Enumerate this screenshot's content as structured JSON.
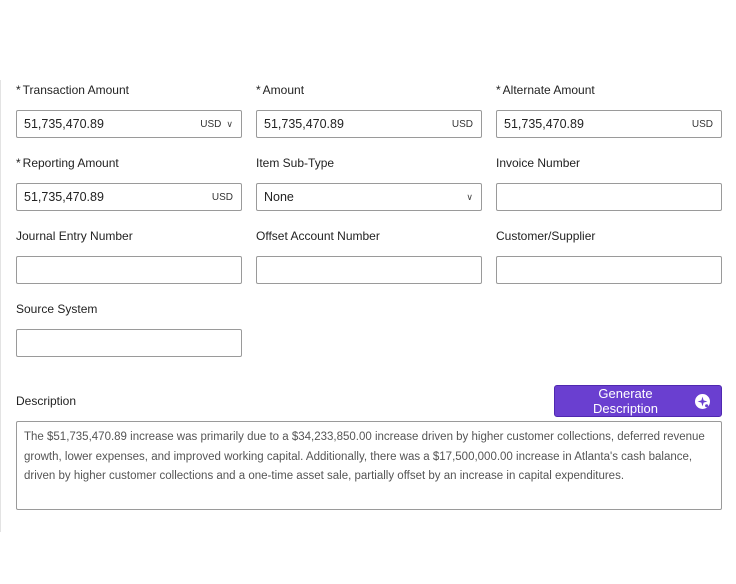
{
  "fields": {
    "transaction_amount": {
      "required_mark": "*",
      "label": "Transaction Amount",
      "value": "51,735,470.89",
      "currency": "USD",
      "chevron_icon": "chevron-down-icon"
    },
    "amount": {
      "required_mark": "*",
      "label": "Amount",
      "value": "51,735,470.89",
      "currency": "USD"
    },
    "alternate_amount": {
      "required_mark": "*",
      "label": "Alternate Amount",
      "value": "51,735,470.89",
      "currency": "USD"
    },
    "reporting_amount": {
      "required_mark": "*",
      "label": "Reporting Amount",
      "value": "51,735,470.89",
      "currency": "USD"
    },
    "item_sub_type": {
      "label": "Item Sub-Type",
      "selected": "None",
      "chevron_icon": "chevron-down-icon"
    },
    "invoice_number": {
      "label": "Invoice Number",
      "value": ""
    },
    "journal_entry_number": {
      "label": "Journal Entry Number",
      "value": ""
    },
    "offset_account_number": {
      "label": "Offset Account Number",
      "value": ""
    },
    "customer_supplier": {
      "label": "Customer/Supplier",
      "value": ""
    },
    "source_system": {
      "label": "Source System",
      "value": ""
    }
  },
  "description": {
    "label": "Description",
    "generate_button_label": "Generate Description",
    "generate_button_icon": "ai-sparkle-icon",
    "text": "The $51,735,470.89 increase was primarily due to a $34,233,850.00 increase driven by higher customer collections, deferred revenue growth, lower expenses, and improved working capital. Additionally, there was a $17,500,000.00 increase in Atlanta's cash balance, driven by higher customer collections and a one-time asset sale, partially offset by an increase in capital expenditures."
  },
  "colors": {
    "accent": "#6a3fd0",
    "border": "#9a9a9a",
    "description_text": "#555555"
  }
}
